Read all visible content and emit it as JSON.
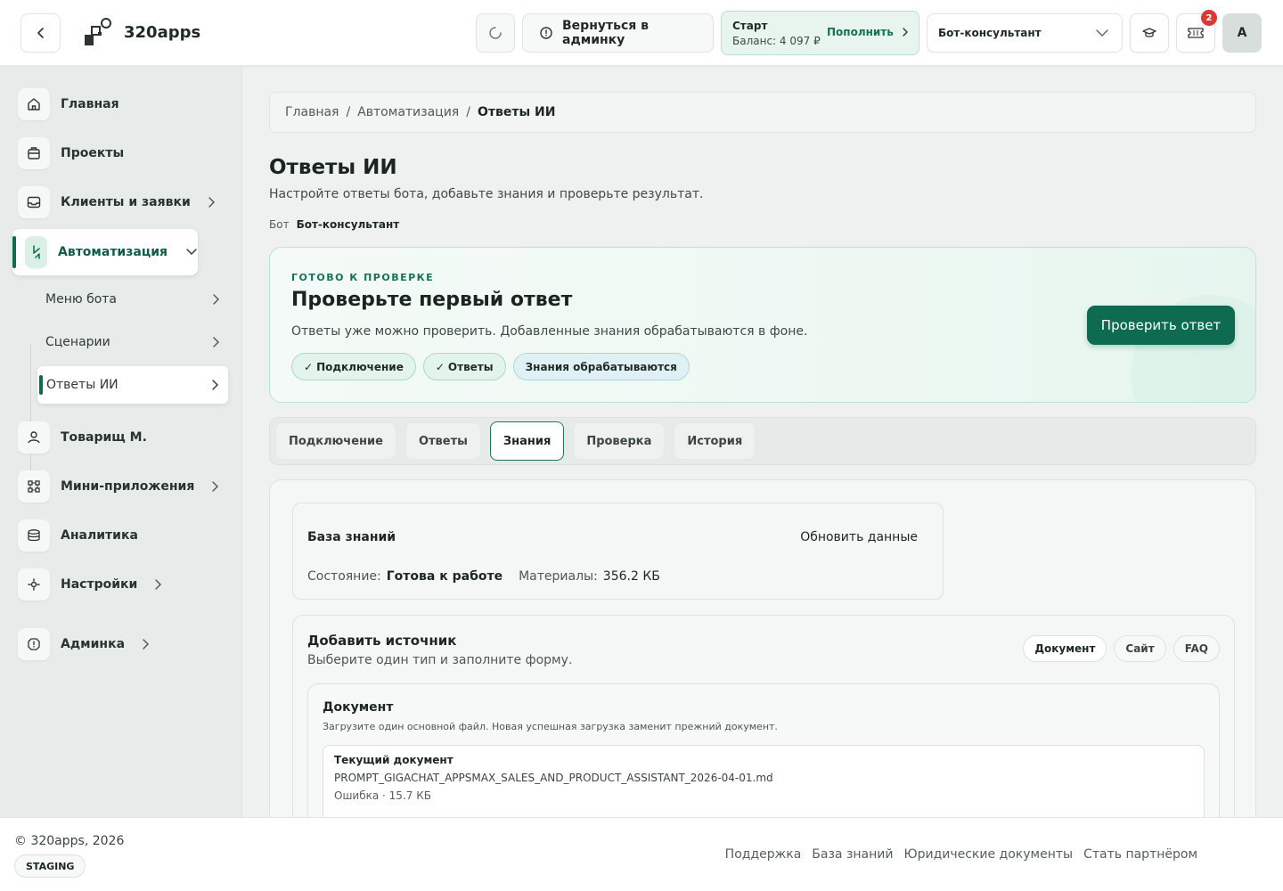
{
  "header": {
    "app_name": "320apps",
    "back_icon": "chevron-left-icon",
    "admin_button": "Вернуться в админку",
    "balance": {
      "plan": "Старт",
      "value": "Баланс: 4 097 ₽",
      "topup": "Пополнить"
    },
    "bot_select": "Бот-консультант",
    "notification_count": "2",
    "avatar_initial": "A"
  },
  "sidebar": {
    "items": [
      {
        "label": "Главная",
        "icon": "home-icon"
      },
      {
        "label": "Проекты",
        "icon": "briefcase-icon"
      },
      {
        "label": "Клиенты и заявки",
        "icon": "inbox-icon"
      },
      {
        "label": "Автоматизация",
        "icon": "automation-icon"
      },
      {
        "label": "Товарищ М.",
        "icon": "user-icon"
      },
      {
        "label": "Мини-приложения",
        "icon": "apps-icon"
      },
      {
        "label": "Аналитика",
        "icon": "database-icon"
      },
      {
        "label": "Настройки",
        "icon": "gear-icon"
      },
      {
        "label": "Админка",
        "icon": "admin-icon"
      }
    ],
    "sub_items": [
      {
        "label": "Меню бота"
      },
      {
        "label": "Сценарии"
      },
      {
        "label": "Ответы ИИ"
      }
    ]
  },
  "breadcrumb": {
    "items": [
      "Главная",
      "Автоматизация",
      "Ответы ИИ"
    ],
    "separator": "/"
  },
  "page": {
    "title": "Ответы ИИ",
    "subtitle": "Настройте ответы бота, добавьте знания и проверьте результат.",
    "bot_label": "Бот",
    "bot_name": "Бот-консультант"
  },
  "status_card": {
    "eyebrow": "ГОТОВО К ПРОВЕРКЕ",
    "title": "Проверьте первый ответ",
    "text": "Ответы уже можно проверить. Добавленные знания обрабатываются в фоне.",
    "pills": [
      "Подключение",
      "Ответы",
      "Знания обрабатываются"
    ],
    "check_mark": "✓",
    "button": "Проверить ответ"
  },
  "tabs": [
    "Подключение",
    "Ответы",
    "Знания",
    "Проверка",
    "История"
  ],
  "active_tab": "Знания",
  "knowledge_base": {
    "title": "База знаний",
    "refresh": "Обновить данные",
    "state_label": "Состояние:",
    "state_value": "Готова к работе",
    "materials_label": "Материалы:",
    "materials_value": "356.2 КБ"
  },
  "add_source": {
    "title": "Добавить источник",
    "subtitle": "Выберите один тип и заполните форму.",
    "types": [
      "Документ",
      "Сайт",
      "FAQ"
    ],
    "document": {
      "title": "Документ",
      "subtitle": "Загрузите один основной файл. Новая успешная загрузка заменит прежний документ.",
      "current_label": "Текущий документ",
      "current_file": "PROMPT_GIGACHAT_APPSMAX_SALES_AND_PRODUCT_ASSISTANT_2026-04-01.md",
      "current_status": "Ошибка · 15.7 КБ"
    }
  },
  "footer": {
    "copyright": "© 320apps, 2026",
    "env_badge": "STAGING",
    "links": [
      "Поддержка",
      "База знаний",
      "Юридические документы",
      "Стать партнёром"
    ]
  },
  "colors": {
    "accent": "#0f6b4f",
    "accent_light": "#e2f4ec",
    "badge_red": "#d83a3a",
    "sidebar_bg": "#e7ebe9",
    "page_bg": "#eef1f0"
  }
}
